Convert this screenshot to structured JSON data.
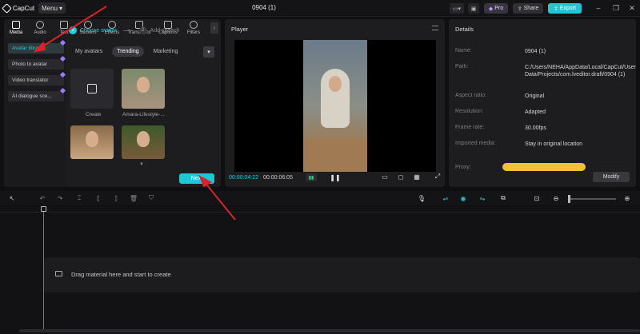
{
  "app": {
    "name": "CapCut",
    "menu_label": "Menu",
    "project_title": "0904 (1)"
  },
  "header": {
    "pro_label": "Pro",
    "share_label": "Share",
    "export_label": "Export"
  },
  "media_tabs": [
    {
      "label": "Media",
      "icon": "media-icon"
    },
    {
      "label": "Audio",
      "icon": "audio-icon"
    },
    {
      "label": "Text",
      "icon": "text-icon"
    },
    {
      "label": "Stickers",
      "icon": "stickers-icon"
    },
    {
      "label": "Effects",
      "icon": "effects-icon"
    },
    {
      "label": "Transitions",
      "icon": "transitions-icon"
    },
    {
      "label": "Captions",
      "icon": "captions-icon"
    },
    {
      "label": "Filters",
      "icon": "filters-icon"
    }
  ],
  "sidebar": {
    "items": [
      {
        "label": "Avatar library",
        "active": true
      },
      {
        "label": "Photo to avatar",
        "active": false
      },
      {
        "label": "Video translator",
        "active": false
      },
      {
        "label": "AI dialogue sce...",
        "active": false
      }
    ]
  },
  "steps": {
    "step1_num": "1",
    "step1_label": "Choose avatar",
    "step2_num": "2",
    "step2_label": "Add speech"
  },
  "filters": {
    "items": [
      "My avatars",
      "Trending",
      "Marketing"
    ],
    "active": "Trending",
    "more_icon": "chevron-down-icon"
  },
  "avatars": {
    "create_label": "Create",
    "avatar1_label": "Amara-Lifestyle-..."
  },
  "next_label": "Next",
  "player": {
    "title": "Player",
    "current_time": "00:00:04:22",
    "total_time": "00:00:06:05"
  },
  "details": {
    "title": "Details",
    "rows": [
      {
        "label": "Name:",
        "value": "0904 (1)"
      },
      {
        "label": "Path:",
        "value": "C:/Users/NEHA/AppData/Local/CapCut/User Data/Projects/com.lveditor.draft/0904 (1)"
      },
      {
        "label": "Aspect ratio:",
        "value": "Original"
      },
      {
        "label": "Resolution:",
        "value": "Adapted"
      },
      {
        "label": "Frame rate:",
        "value": "30.00fps"
      },
      {
        "label": "Imported media:",
        "value": "Stay in original location"
      },
      {
        "label": "Proxy:",
        "value": ""
      }
    ],
    "modify_label": "Modify"
  },
  "timeline": {
    "drop_text": "Drag material here and start to create"
  },
  "colors": {
    "accent": "#1fc6d3",
    "annotation": "#d9232b",
    "pro": "#9b7bff"
  }
}
